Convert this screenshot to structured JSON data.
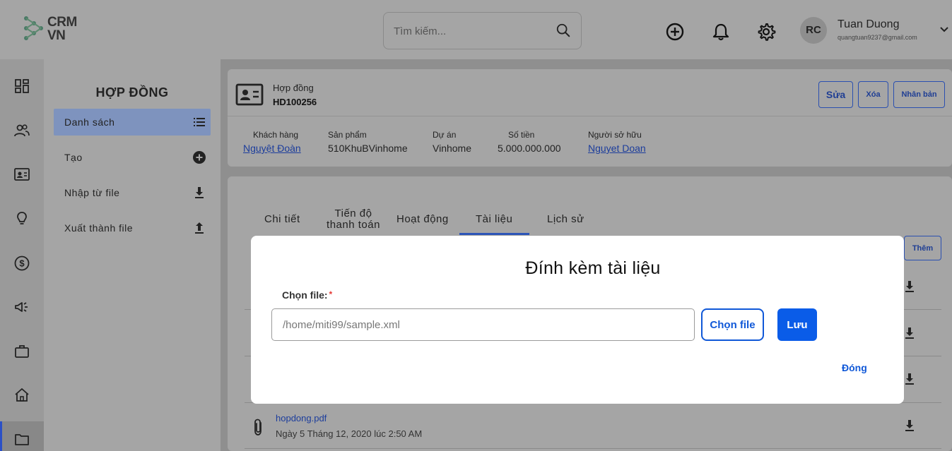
{
  "header": {
    "logo_text_line1": "CRM",
    "logo_text_line2": "VN",
    "search_placeholder": "Tìm kiếm...",
    "user": {
      "initials": "RC",
      "name": "Tuan Duong",
      "email": "quangtuan9237@gmail.com"
    }
  },
  "rail": {
    "icons": [
      "dashboard-icon",
      "users-icon",
      "contact-card-icon",
      "lightbulb-icon",
      "dollar-icon",
      "megaphone-icon",
      "briefcase-icon",
      "home-icon",
      "folder-icon"
    ]
  },
  "submenu": {
    "title": "HỢP ĐỒNG",
    "items": [
      {
        "label": "Danh sách",
        "icon": "list-icon"
      },
      {
        "label": "Tạo",
        "icon": "plus-circle-icon"
      },
      {
        "label": "Nhập từ file",
        "icon": "download-icon"
      },
      {
        "label": "Xuất thành file",
        "icon": "upload-icon"
      }
    ]
  },
  "contract": {
    "type_label": "Hợp đồng",
    "code": "HD100256",
    "actions": {
      "edit": "Sửa",
      "delete": "Xóa",
      "duplicate": "Nhân bản"
    },
    "fields": [
      {
        "label": "Khách hàng",
        "value": "Nguyệt Đoàn"
      },
      {
        "label": "Sản phẩm",
        "value": "510KhuBVinhome"
      },
      {
        "label": "Dự án",
        "value": "Vinhome"
      },
      {
        "label": "Số tiền",
        "value": "5.000.000.000"
      },
      {
        "label": "Người sở hữu",
        "value": "Nguyet Doan"
      }
    ]
  },
  "tabs": [
    {
      "label": "Chi tiết"
    },
    {
      "label": "Tiến độ thanh toán"
    },
    {
      "label": "Hoạt động"
    },
    {
      "label": "Tài liệu"
    },
    {
      "label": "Lịch sử"
    }
  ],
  "documents": {
    "add_label": "Thêm",
    "files": [
      {
        "name": "hopdong.pdf",
        "date": "Ngày 5 Tháng 12, 2020 lúc 2:50 AM"
      }
    ]
  },
  "modal": {
    "title": "Đính kèm tài liệu",
    "file_label": "Chọn file:",
    "required_mark": "*",
    "file_value": "/home/miti99/sample.xml",
    "choose_label": "Chọn file",
    "save_label": "Lưu",
    "close_label": "Đóng"
  },
  "colors": {
    "primary": "#0a5ce8",
    "accent_dim": "#2a4fb0",
    "overlay_gray": "#a5a5a5"
  }
}
